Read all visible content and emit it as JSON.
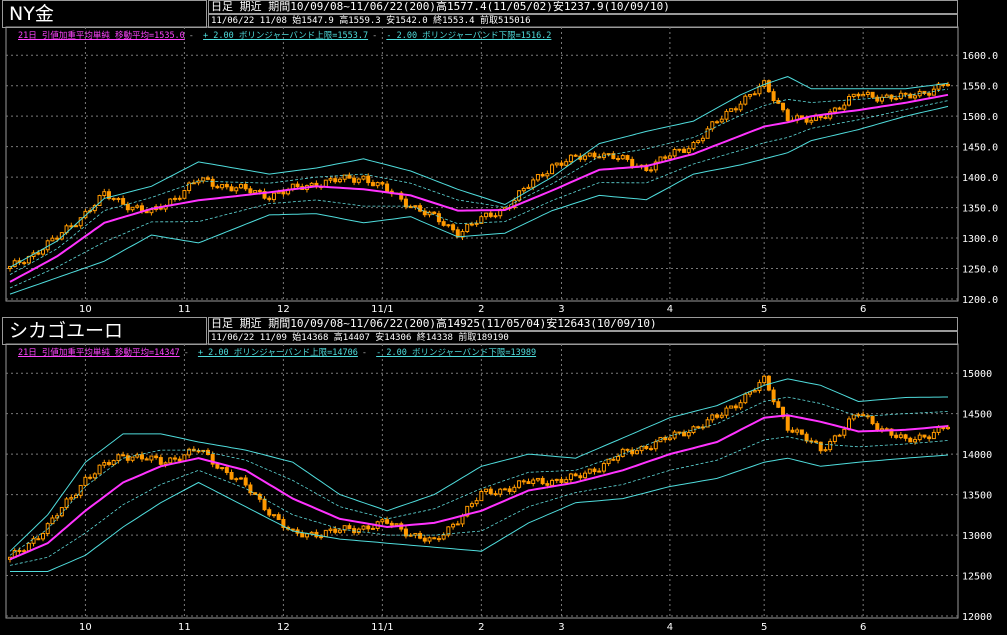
{
  "colors": {
    "ma": "#ff33ff",
    "band": "#4fdcdc",
    "inner": "#5fd8d8",
    "candle": "#ff9900",
    "grid": "#7a7a7a",
    "axis": "#9a9a9a"
  },
  "chart_data": [
    {
      "type": "line",
      "title": "NY金",
      "info_line1": "日足 期近 期間10/09/08~11/06/22(200)高1577.4(11/05/02)安1237.9(10/09/10)",
      "info_line2": "11/06/22 11/08 始1547.9 高1559.3 安1542.0 終1553.4 前取515016",
      "legend": {
        "ma": "21日 引値加重平均単純 移動平均=1535.0",
        "sep1": "-",
        "upper": "+ 2.00 ボリンジャーバンド上限=1553.7",
        "sep2": "-",
        "lower": "- 2.00 ボリンジャーバンド下限=1516.2"
      },
      "ylim": [
        1200,
        1625
      ],
      "yticks": [
        1200,
        1250,
        1300,
        1350,
        1400,
        1450,
        1500,
        1550,
        1600
      ],
      "ytick_labels": [
        "1200.0",
        "1250.0",
        "1300.0",
        "1350.0",
        "1400.0",
        "1450.0",
        "1500.0",
        "1550.0",
        "1600.0"
      ],
      "xticks": [
        {
          "label": "10",
          "day": 16
        },
        {
          "label": "11",
          "day": 37
        },
        {
          "label": "12",
          "day": 58
        },
        {
          "label": "11/1",
          "day": 79
        },
        {
          "label": "2",
          "day": 100
        },
        {
          "label": "3",
          "day": 117
        },
        {
          "label": "4",
          "day": 140
        },
        {
          "label": "5",
          "day": 160
        },
        {
          "label": "6",
          "day": 181
        }
      ],
      "n_days": 200,
      "x_days": [
        0,
        10,
        20,
        30,
        40,
        55,
        65,
        75,
        85,
        95,
        105,
        115,
        125,
        135,
        145,
        155,
        160,
        165,
        170,
        180,
        190,
        199
      ],
      "ma": [
        1228,
        1270,
        1325,
        1348,
        1362,
        1375,
        1385,
        1380,
        1370,
        1345,
        1346,
        1378,
        1412,
        1418,
        1438,
        1468,
        1483,
        1490,
        1500,
        1510,
        1522,
        1535
      ],
      "upper": [
        1252,
        1295,
        1365,
        1385,
        1425,
        1405,
        1415,
        1430,
        1410,
        1380,
        1355,
        1400,
        1455,
        1475,
        1492,
        1535,
        1552,
        1565,
        1545,
        1545,
        1545,
        1554
      ],
      "lower": [
        1208,
        1235,
        1262,
        1305,
        1292,
        1338,
        1340,
        1325,
        1335,
        1302,
        1308,
        1345,
        1370,
        1363,
        1405,
        1420,
        1430,
        1440,
        1460,
        1478,
        1500,
        1516
      ],
      "close": [
        1250,
        1300,
        1370,
        1340,
        1395,
        1370,
        1390,
        1400,
        1355,
        1310,
        1350,
        1420,
        1440,
        1415,
        1455,
        1525,
        1550,
        1500,
        1490,
        1535,
        1530,
        1553
      ]
    },
    {
      "type": "line",
      "title": "シカゴユーロ",
      "info_line1": "日足 期近 期間10/09/08~11/06/22(200)高14925(11/05/04)安12643(10/09/10)",
      "info_line2": "11/06/22 11/09 始14368 高14407 安14306 終14338 前取189190",
      "legend": {
        "ma": "21日 引値加重平均単純 移動平均=14347",
        "sep1": "-",
        "upper": "+ 2.00 ボリンジャーバンド上限=14706",
        "sep2": "-",
        "lower": "- 2.00 ボリンジャーバンド下限=13989"
      },
      "ylim": [
        12000,
        15200
      ],
      "yticks": [
        12000,
        12500,
        13000,
        13500,
        14000,
        14500,
        15000
      ],
      "ytick_labels": [
        "12000",
        "12500",
        "13000",
        "13500",
        "14000",
        "14500",
        "15000"
      ],
      "xticks": [
        {
          "label": "10",
          "day": 16
        },
        {
          "label": "11",
          "day": 37
        },
        {
          "label": "12",
          "day": 58
        },
        {
          "label": "11/1",
          "day": 79
        },
        {
          "label": "2",
          "day": 100
        },
        {
          "label": "3",
          "day": 117
        },
        {
          "label": "4",
          "day": 140
        },
        {
          "label": "5",
          "day": 160
        },
        {
          "label": "6",
          "day": 181
        }
      ],
      "n_days": 200,
      "x_days": [
        0,
        8,
        16,
        24,
        32,
        40,
        50,
        60,
        70,
        80,
        90,
        100,
        110,
        120,
        130,
        140,
        150,
        160,
        165,
        172,
        180,
        190,
        199
      ],
      "ma": [
        12700,
        12900,
        13300,
        13650,
        13850,
        13950,
        13800,
        13450,
        13200,
        13100,
        13150,
        13300,
        13550,
        13650,
        13800,
        14000,
        14150,
        14450,
        14480,
        14400,
        14280,
        14300,
        14347
      ],
      "upper": [
        12800,
        13250,
        13900,
        14250,
        14250,
        14150,
        14050,
        13900,
        13500,
        13300,
        13500,
        13850,
        14000,
        13950,
        14200,
        14450,
        14600,
        14850,
        14930,
        14850,
        14650,
        14700,
        14706
      ],
      "lower": [
        12550,
        12550,
        12750,
        13100,
        13400,
        13650,
        13350,
        13050,
        12950,
        12900,
        12850,
        12800,
        13150,
        13400,
        13450,
        13600,
        13700,
        13900,
        13950,
        13850,
        13900,
        13950,
        13989
      ],
      "close": [
        12700,
        13100,
        13700,
        14000,
        13900,
        14050,
        13600,
        13000,
        13050,
        13150,
        12900,
        13500,
        13650,
        13700,
        14000,
        14200,
        14450,
        14900,
        14350,
        14050,
        14500,
        14150,
        14338
      ]
    }
  ]
}
